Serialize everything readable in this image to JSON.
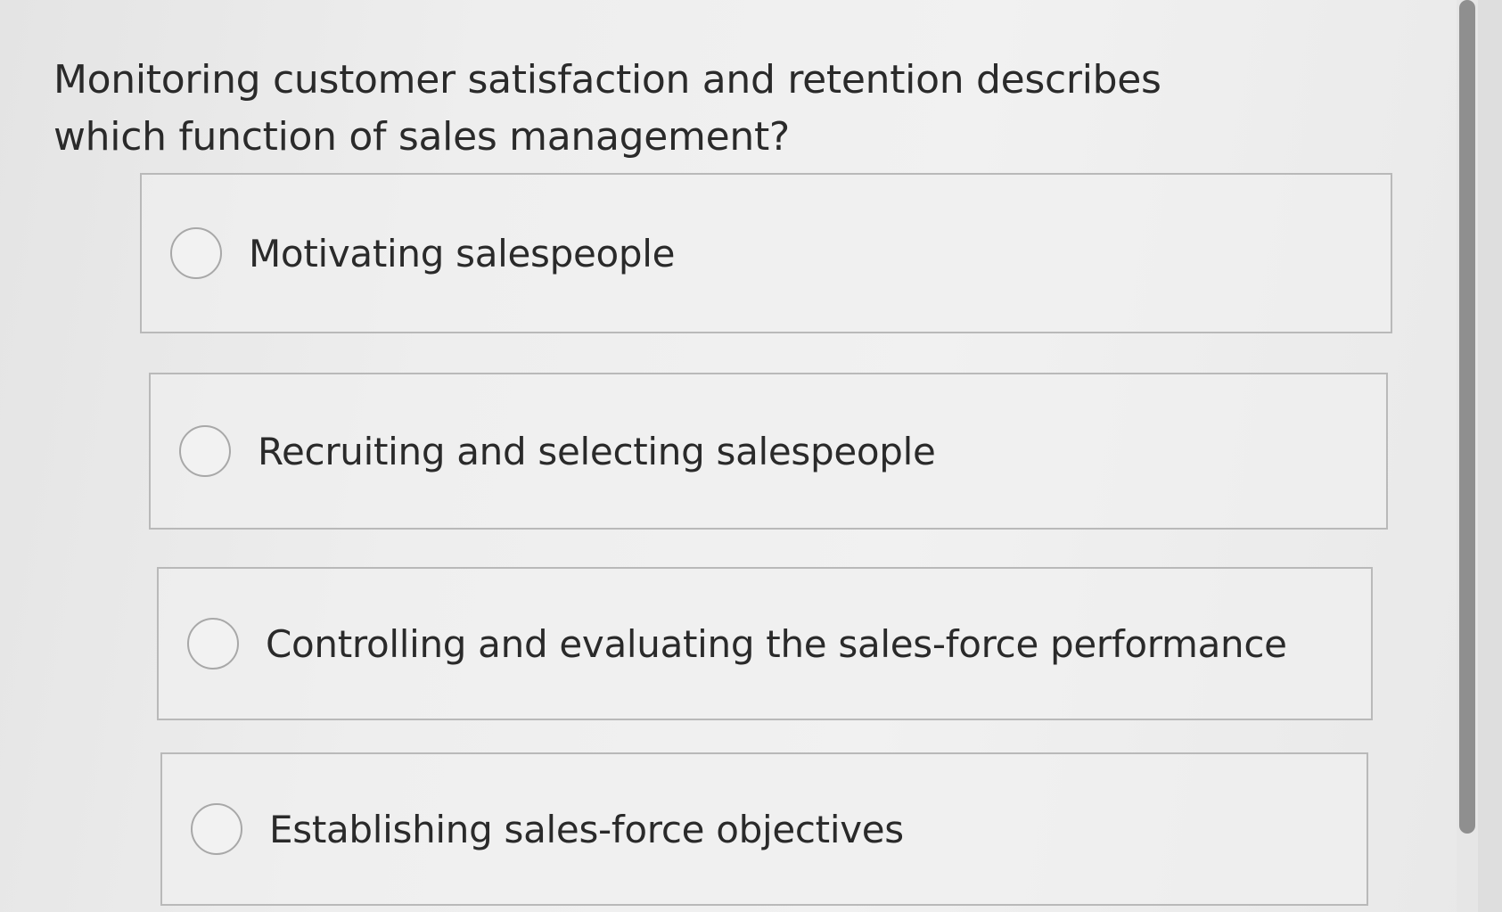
{
  "question": {
    "text": "Monitoring customer satisfaction and retention describes which function of sales management?"
  },
  "options": [
    {
      "label": "Motivating salespeople",
      "selected": false
    },
    {
      "label": "Recruiting and selecting salespeople",
      "selected": false
    },
    {
      "label": "Controlling and evaluating the sales-force performance",
      "selected": false
    },
    {
      "label": "Establishing sales-force objectives",
      "selected": false
    }
  ]
}
